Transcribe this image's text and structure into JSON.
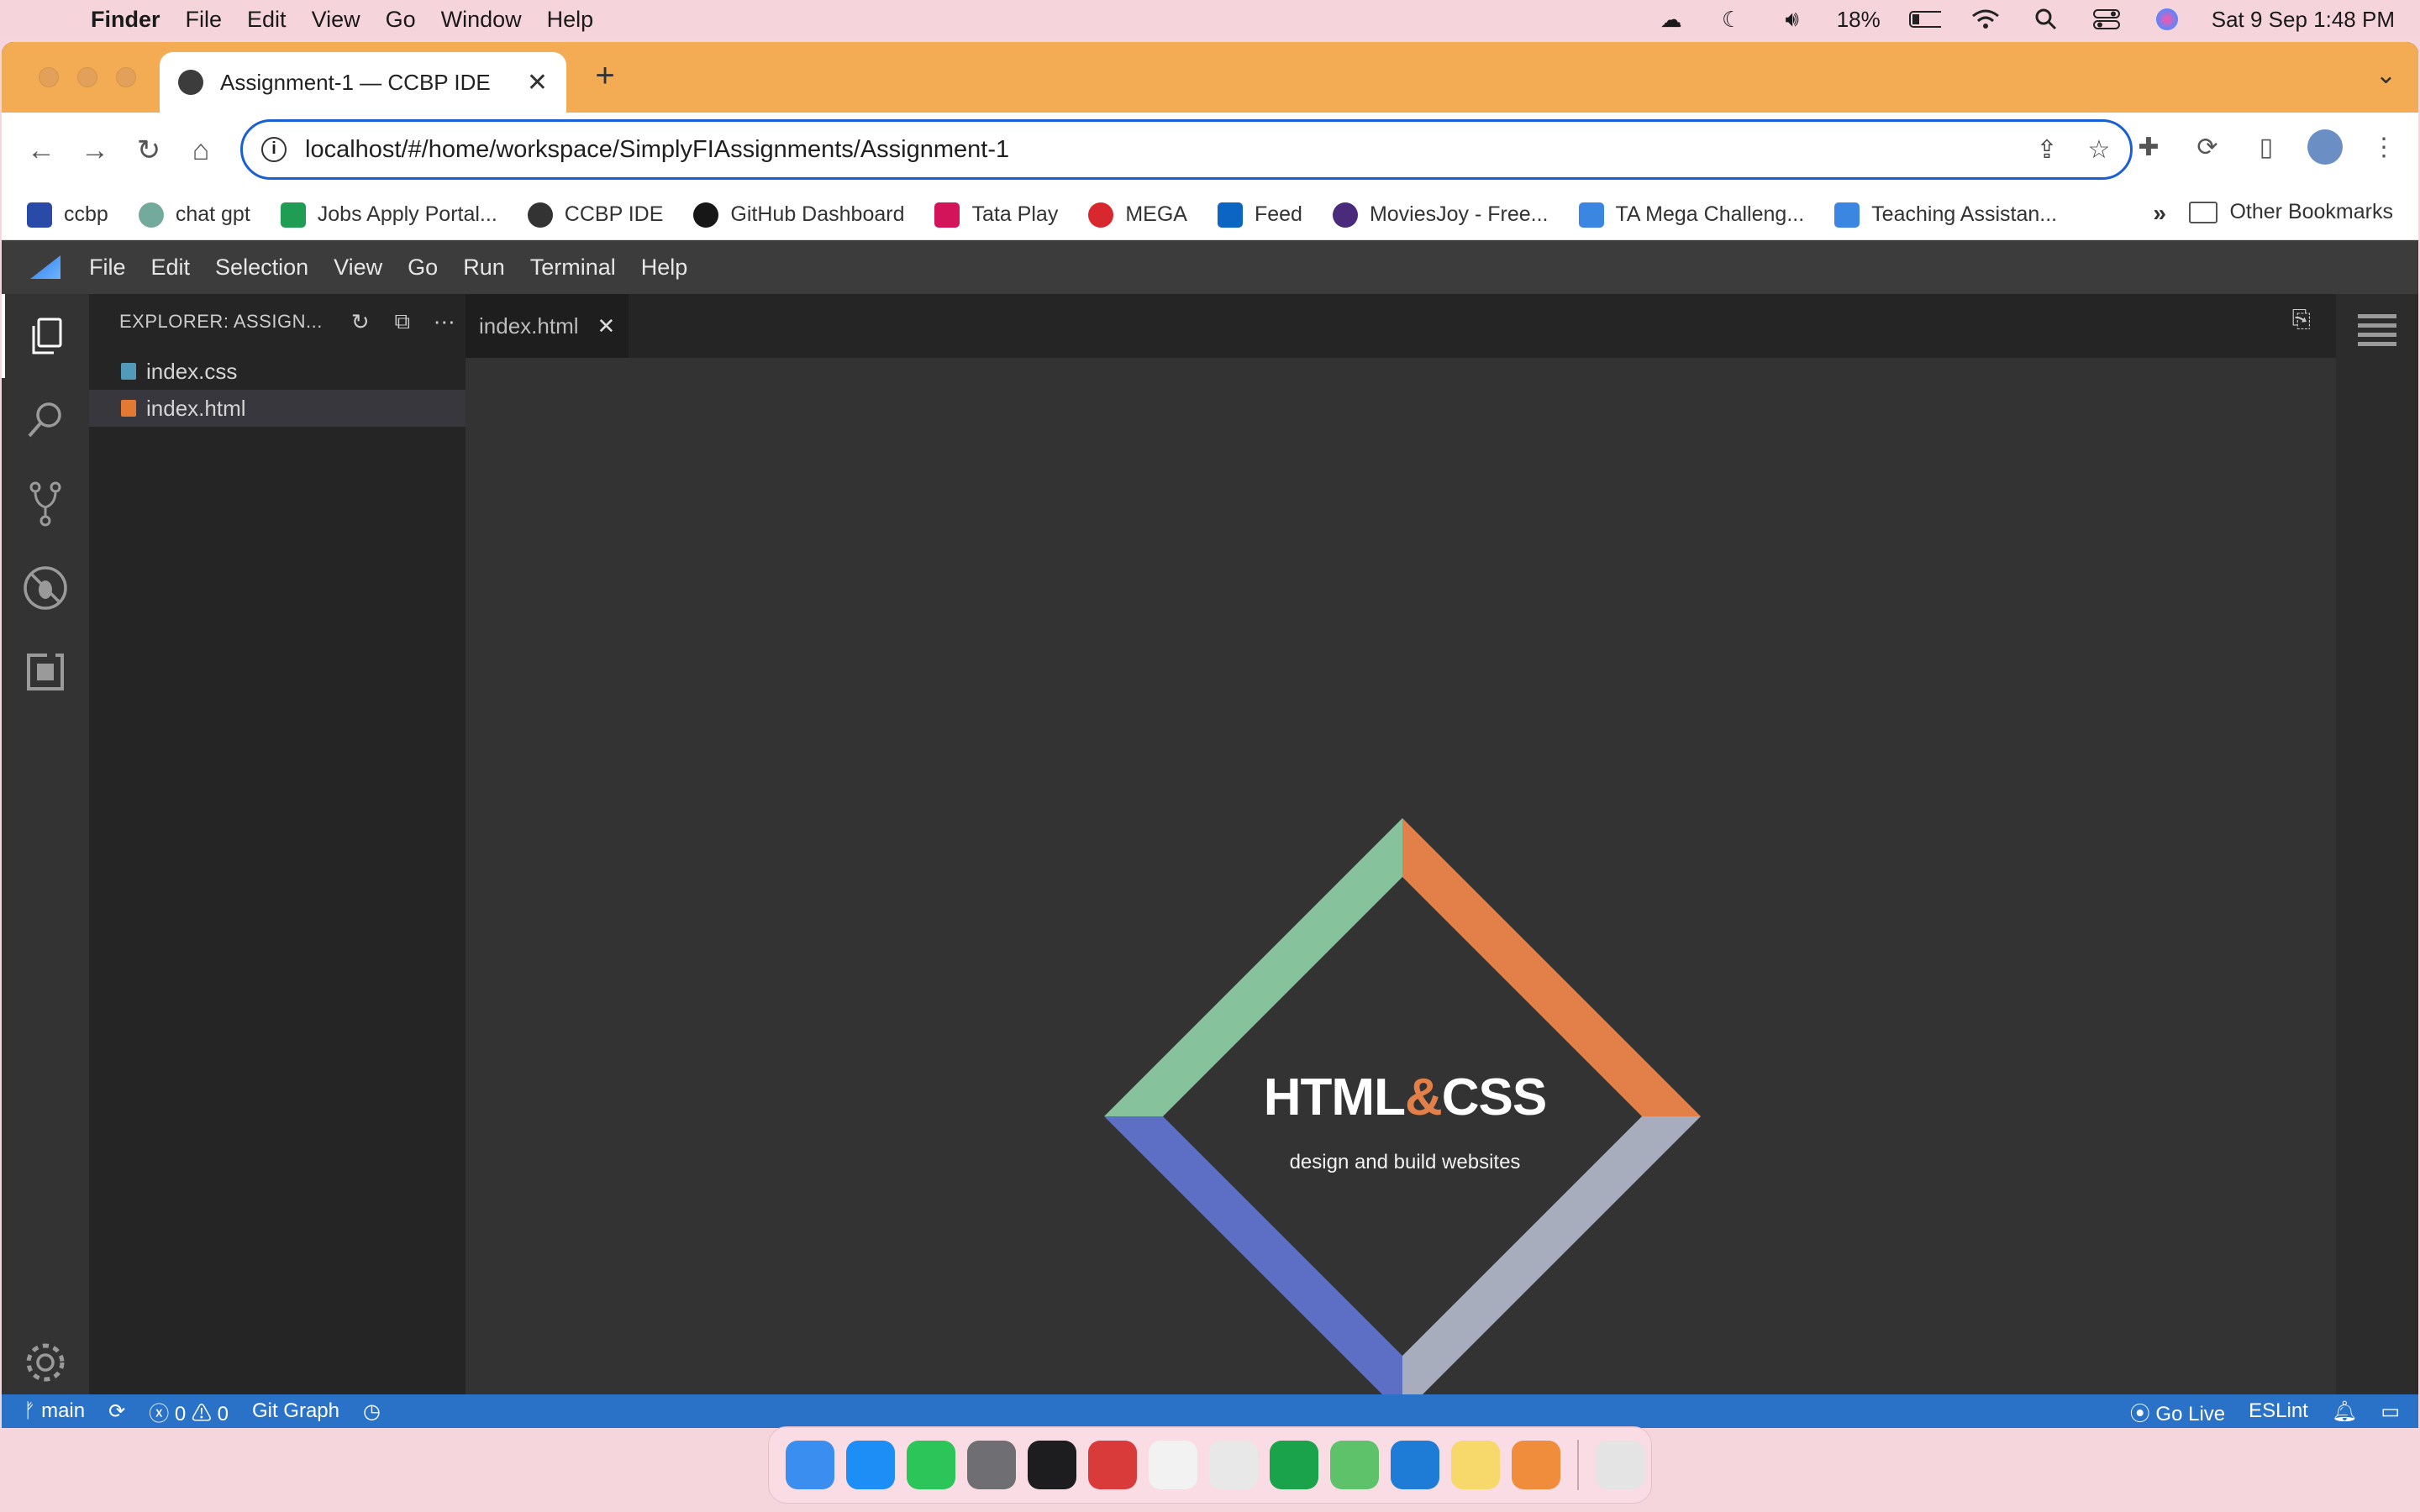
{
  "mac_menubar": {
    "app": "Finder",
    "items": [
      "File",
      "Edit",
      "View",
      "Go",
      "Window",
      "Help"
    ],
    "battery": "18%",
    "datetime": "Sat 9 Sep  1:48 PM"
  },
  "browser": {
    "tab_title": "Assignment-1 — CCBP IDE",
    "url": "localhost/#/home/workspace/SimplyFIAssignments/Assignment-1",
    "bookmarks": [
      "ccbp",
      "chat gpt",
      "Jobs Apply Portal...",
      "CCBP IDE",
      "GitHub Dashboard",
      "Tata Play",
      "MEGA",
      "Feed",
      "MoviesJoy - Free...",
      "TA Mega Challeng...",
      "Teaching Assistan..."
    ],
    "bookmarks_more": "»",
    "other_bookmarks": "Other Bookmarks"
  },
  "ide": {
    "menu": [
      "File",
      "Edit",
      "Selection",
      "View",
      "Go",
      "Run",
      "Terminal",
      "Help"
    ],
    "explorer_title": "EXPLORER: ASSIGN...",
    "files": [
      {
        "name": "index.css",
        "color": "#519aba"
      },
      {
        "name": "index.html",
        "color": "#e37933"
      }
    ],
    "active_tab": "index.html",
    "preview": {
      "title_part1": "HTML",
      "title_amp": "&",
      "title_part2": "CSS",
      "subtitle": "design and build websites",
      "colors": {
        "green": "#86c29c",
        "orange": "#e3804a",
        "blue": "#5c6fc4",
        "gray": "#a8adbd"
      }
    },
    "status": {
      "branch": "main",
      "errors": "0",
      "warnings": "0",
      "git_graph": "Git Graph",
      "go_live": "Go Live",
      "eslint": "ESLint"
    }
  },
  "dock": {
    "apps": [
      "finder-icon",
      "app-store-icon",
      "whatsapp-icon",
      "system-settings-icon",
      "terminal-icon",
      "photo-booth-icon",
      "screenshot-icon",
      "chrome-icon",
      "pycharm-icon",
      "circle-app-icon",
      "vscode-icon",
      "notes-icon",
      "launchpad-icon",
      "trash-icon"
    ],
    "colors": [
      "#3a8ef0",
      "#1c8ef5",
      "#2cc55a",
      "#6e6e73",
      "#1d1d1f",
      "#d93b3b",
      "#f2f2f2",
      "#e8e8e8",
      "#1aa34a",
      "#5ec26a",
      "#1e7bd6",
      "#f6d86b",
      "#f08d3c",
      "#e4e4e4"
    ]
  }
}
